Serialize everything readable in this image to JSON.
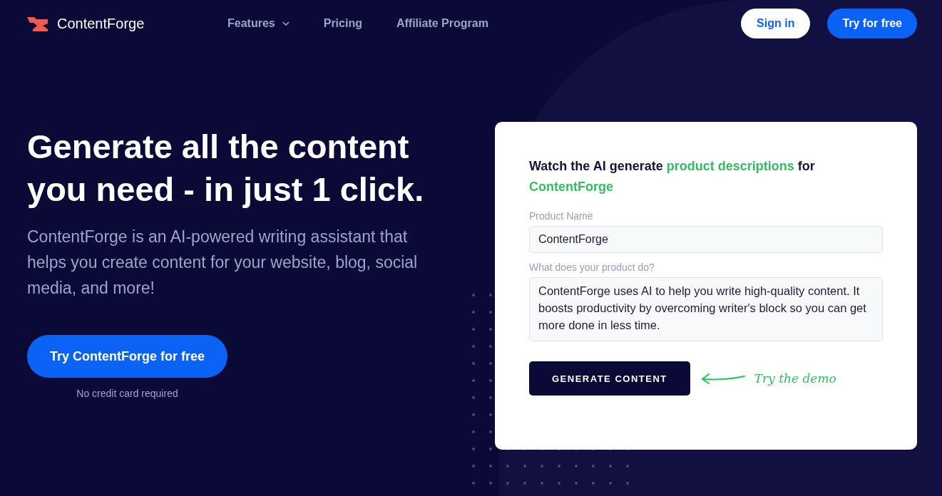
{
  "nav": {
    "brand": "ContentForge",
    "links": [
      {
        "label": "Features",
        "has_dropdown": true
      },
      {
        "label": "Pricing",
        "has_dropdown": false
      },
      {
        "label": "Affiliate Program",
        "has_dropdown": false
      }
    ],
    "sign_in": "Sign in",
    "try_free": "Try for free"
  },
  "hero": {
    "heading": "Generate all the content you need - in just 1 click.",
    "subtitle": "ContentForge is an AI-powered writing assistant that helps you create content for your website, blog, social media, and more!",
    "cta": "Try ContentForge for free",
    "cta_note": "No credit card required"
  },
  "demo": {
    "title_parts": [
      {
        "text": "Watch the AI generate ",
        "highlight": false
      },
      {
        "text": "product descriptions",
        "highlight": true
      },
      {
        "text": " for ",
        "highlight": false
      },
      {
        "text": "ContentForge",
        "highlight": true
      }
    ],
    "fields": [
      {
        "label": "Product Name",
        "value": "ContentForge",
        "kind": "input"
      },
      {
        "label": "What does your product do?",
        "value": "ContentForge uses AI to help you write high-quality content. It boosts productivity by overcoming writer's block so you can get more done in less time.",
        "kind": "textarea"
      }
    ],
    "button": "GENERATE CONTENT",
    "hint": "Try the demo"
  }
}
